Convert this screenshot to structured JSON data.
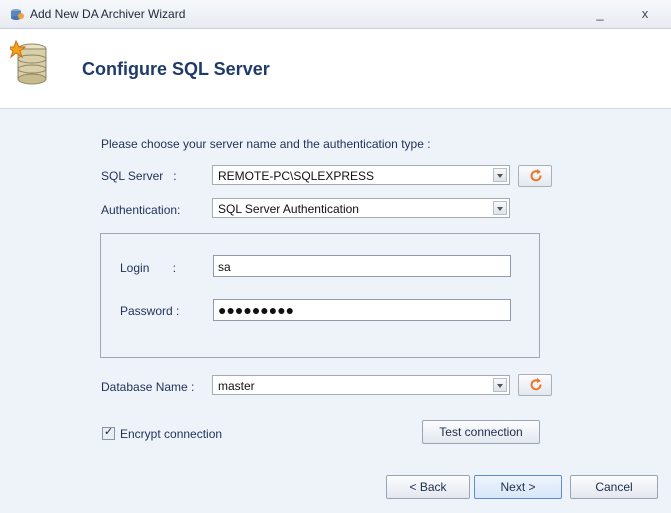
{
  "window": {
    "title": "Add New DA Archiver Wizard",
    "minimize_glyph": "_",
    "close_glyph": "x"
  },
  "header": {
    "title": "Configure SQL Server",
    "icon": "database-icon"
  },
  "form": {
    "instruction": "Please choose your server name and the authentication type :",
    "sql_server_label": "SQL Server   :",
    "sql_server_value": "REMOTE-PC\\SQLEXPRESS",
    "auth_label": "Authentication:",
    "auth_value": "SQL Server Authentication",
    "login_label": "Login       :",
    "login_value": "sa",
    "password_label": "Password :",
    "password_mask": "●●●●●●●●●",
    "database_label": "Database Name :",
    "database_value": "master",
    "encrypt_label": "Encrypt connection",
    "encrypt_checked": true,
    "test_button": "Test connection"
  },
  "footer": {
    "back": "< Back",
    "next": "Next >",
    "cancel": "Cancel"
  },
  "colors": {
    "accent": "#1f3b6b",
    "content_bg": "#eef3f9",
    "refresh_icon": "#e8762c"
  }
}
